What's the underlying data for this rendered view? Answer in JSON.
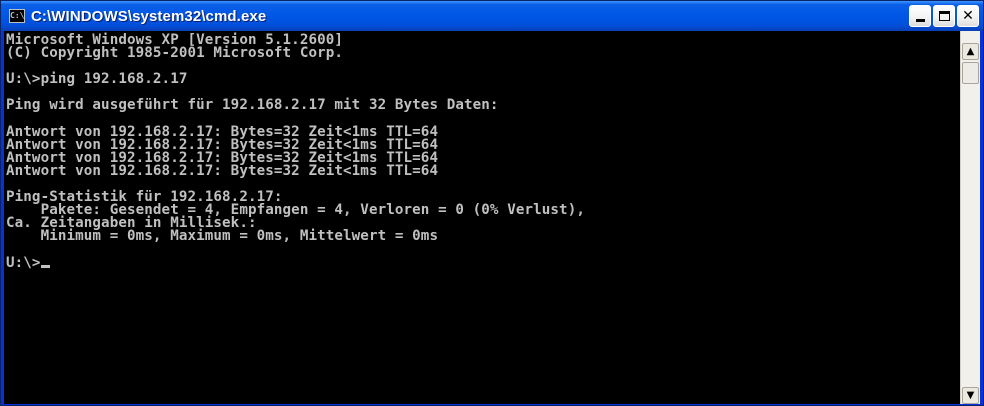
{
  "window": {
    "title": "C:\\WINDOWS\\system32\\cmd.exe",
    "icon_label": "C:\\"
  },
  "console": {
    "lines": [
      "Microsoft Windows XP [Version 5.1.2600]",
      "(C) Copyright 1985-2001 Microsoft Corp.",
      "",
      "U:\\>ping 192.168.2.17",
      "",
      "Ping wird ausgeführt für 192.168.2.17 mit 32 Bytes Daten:",
      "",
      "Antwort von 192.168.2.17: Bytes=32 Zeit<1ms TTL=64",
      "Antwort von 192.168.2.17: Bytes=32 Zeit<1ms TTL=64",
      "Antwort von 192.168.2.17: Bytes=32 Zeit<1ms TTL=64",
      "Antwort von 192.168.2.17: Bytes=32 Zeit<1ms TTL=64",
      "",
      "Ping-Statistik für 192.168.2.17:",
      "    Pakete: Gesendet = 4, Empfangen = 4, Verloren = 0 (0% Verlust),",
      "Ca. Zeitangaben in Millisek.:",
      "    Minimum = 0ms, Maximum = 0ms, Mittelwert = 0ms",
      "",
      "U:\\>"
    ]
  },
  "colors": {
    "console_bg": "#000000",
    "console_fg": "#c0c0c0",
    "titlebar": "#0058e6"
  },
  "icons": {
    "window_icon": "cmd-icon",
    "minimize": "minimize-icon",
    "maximize": "maximize-icon",
    "close": "close-icon",
    "scroll_up": "arrow-up-icon",
    "scroll_down": "arrow-down-icon"
  }
}
